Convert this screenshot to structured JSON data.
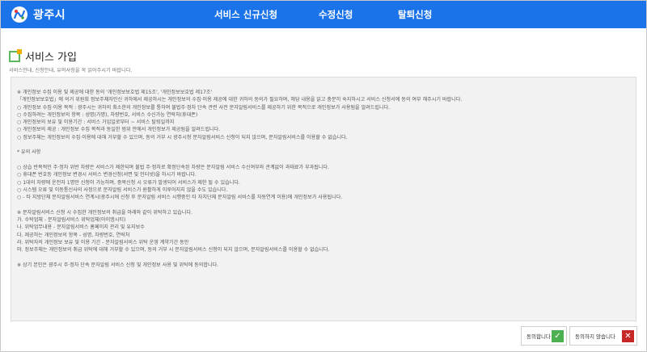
{
  "header": {
    "logo_text": "광주시",
    "nav": [
      "서비스 신규신청",
      "수정신청",
      "탈퇴신청"
    ]
  },
  "page": {
    "title": "서비스 가입",
    "subtitle": "서비스안내, 신청안내, 유의사항을 꼭 읽어주시기 바랍니다."
  },
  "terms": [
    "※ 개인정보 수집 이용 및 제공에 대한 동의 '개인정보보호법 제15조', '개인정보보호법 제17조'",
    "「개인정보보호법」에 의거 위원회 정보주체자인신 귀하에서 제공하시는 개인정보의 수집·이용 제공에 대한 귀하의 동의가 필요하며, 해당 내용을 읽고 충분히 숙지하시고 서비스 신청서에 동의 여부 해주시기 바랍니다.",
    "○ 개인정보 수집·이용 목적 : 광주시는 귀하의 최소한의 개인정보를 통하여 불법주·정차 단속 관련 사전 문자알림서비스를 제공하기 위한 목적으로 개인정보가 사용됨을 알려드립니다.",
    "○ 수집하려는 개인정보의 항목 : 성명(가명), 차량번호, 서비스 수신가능 연락처(휴대폰)",
    "○ 개인정보의 보유 및 이용기간 : 서비스 가입일로부터 ~ 서비스 탈퇴일까지",
    "○ 개인정보의 제공 : 개인정보 수집 목적과 동일한 범위 안에서 개인정보가 제공됨을 알려드립니다.",
    "○ 정보주체는 개인정보의 수집·이용에 대해 거부할 수 있으며, 동의 거부 시 광주시청 문자알림서비스 신청이 되지 않으며, 문자알림서비스를 이용할 수 없습니다.",
    "",
    "* 유의 사항",
    "",
    "○ 상습 반복적인 주·정차 위반 차량은 서비스가 제한되며 불법 주·정차로 확정단속된 차량은 문자알림 서비스 수신여부와 관계없이 과태료가 부과됩니다.",
    "○ 휴대폰 번호등 개인정보 변경시 서비스 변경신청(서면 및 인터넷)을 하시기 바랍니다.",
    "○ 1대의 차량에 운전자 1명만 신청이 가능하며, 중복신청 시 오류가 발생되어 서비스가 제한 될 수 있습니다.",
    "○ 시스템 오류 및 이동통신사의 사정으로 문자알림 서비스가 원활하게 이루어지지 않을 수도 있습니다.",
    "○ - 타 지방단체 문자알림서비스 연계시(광주시에 신청 후 문자알림 서비스 시행중인 타 자치단체 문자알림 서비스를 자동연계 이용)에 개인정보가 사용됩니다.",
    "",
    "※ 문자알림서비스 신청 시 수집한 개인정보의 취급을 아래와 같이 위탁하고 있습니다.",
    "가. 수탁업체 - 문자알림서비스 위탁업체(아이엠시티)",
    "나. 위탁업무내용 - 문자알림서비스 홈페이지 관리 및 유지보수",
    "다. 제공하는 개인정보의 항목 - 성명, 차량번호, 연락처",
    "라. 위탁자의 개인정보 보유 및 이용 기간 - 문자알림서비스 위탁 운영 계약기간 동안",
    "마. 정보주체는 개인정보의 취급 위탁에 대해 거부할 수 있으며, 동의 거부 시 문자알림서비스 신청이 되지 않으며, 문자알림서비스를 이용할 수 없습니다.",
    "",
    "※ 상기 본인은 광주시 주·정차 단속 문자알림 서비스 신청 및 개인정보 사용 및 위탁에 동의합니다."
  ],
  "buttons": {
    "agree_label": "동의합니다",
    "disagree_label": "동의하지 않습니다"
  },
  "colors": {
    "header_bg": "#1a73e8",
    "agree_icon": "#4caf50",
    "disagree_icon": "#c62828"
  },
  "icons": {
    "agree": "check-icon",
    "disagree": "close-icon"
  }
}
